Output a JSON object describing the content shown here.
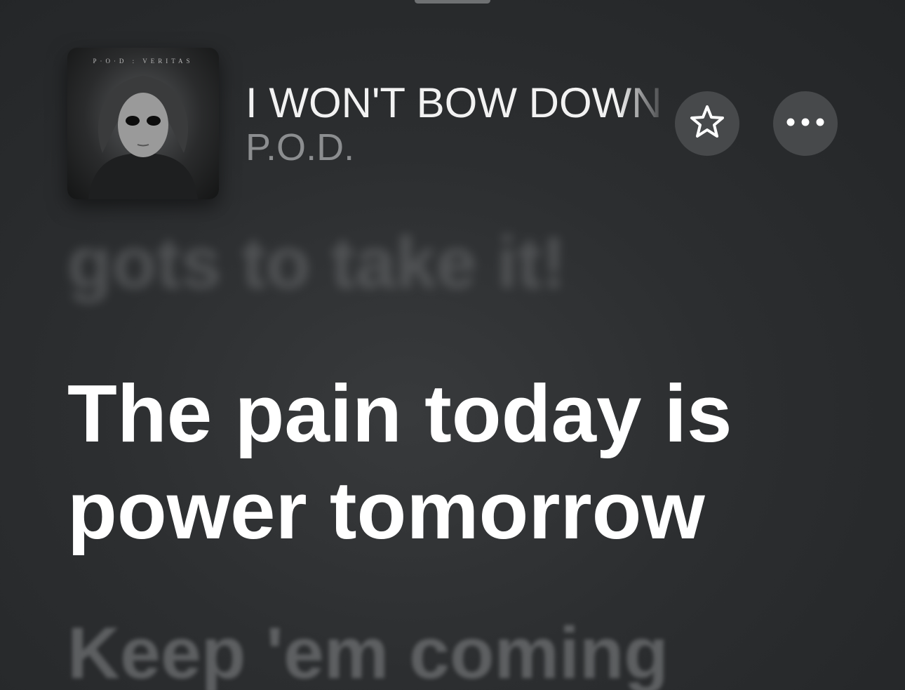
{
  "now_playing": {
    "artwork": {
      "icon": "album-artwork",
      "caption": "P·O·D : VERITAS"
    },
    "title": "I WON'T BOW DOWN",
    "artist": "P.O.D.",
    "favorite_icon": "star-outline-icon",
    "more_icon": "ellipsis-icon"
  },
  "lyrics": {
    "previous": "gots to take it!",
    "current": "The pain today is power tomorrow",
    "next": "Keep 'em coming"
  },
  "colors": {
    "background": "#2c2e30",
    "button_background": "#47494b",
    "current_lyric": "#ffffff",
    "inactive_lyric": "#6e7072",
    "artist_text": "#8c8e90"
  }
}
